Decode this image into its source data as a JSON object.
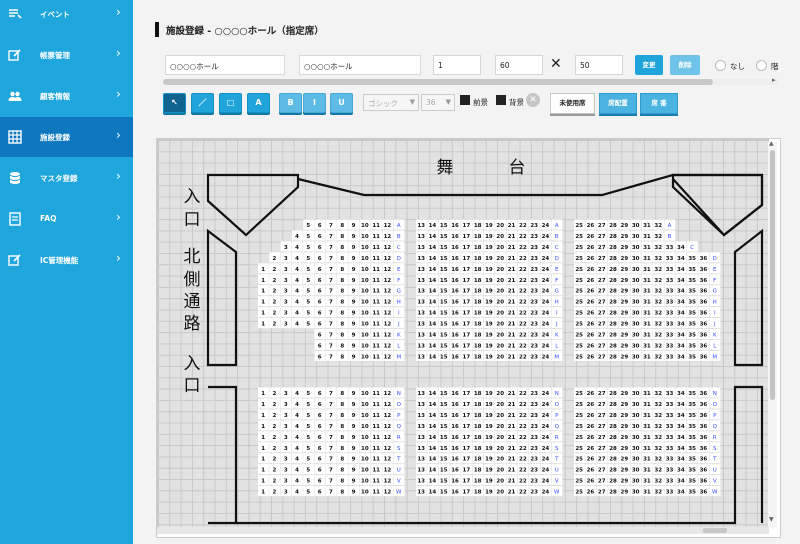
{
  "sidebar": {
    "items": [
      {
        "label": "イベント",
        "icon": "event-list-icon",
        "active": false
      },
      {
        "label": "帳票管理",
        "icon": "edit-icon",
        "active": false
      },
      {
        "label": "顧客情報",
        "icon": "users-icon",
        "active": false
      },
      {
        "label": "施設登録",
        "icon": "grid-icon",
        "active": true
      },
      {
        "label": "マスタ登録",
        "icon": "database-icon",
        "active": false
      },
      {
        "label": "FAQ",
        "icon": "document-icon",
        "active": false
      },
      {
        "label": "IC管理機能",
        "icon": "edit-icon",
        "active": false
      }
    ]
  },
  "header": {
    "title": "施設登録 - ○○○○ホール（指定席）"
  },
  "form": {
    "name1": "○○○○ホール",
    "name2": "○○○○ホール",
    "floor": "1",
    "rows": "60",
    "times": "✕",
    "cols": "50",
    "change_label": "変更",
    "delete_label": "削除",
    "radio1": "なし",
    "radio2": "階"
  },
  "toolbar": {
    "tools": [
      "↖",
      "／",
      "□",
      "A"
    ],
    "styles": [
      "B",
      "I",
      "U"
    ],
    "font": "ゴシック",
    "size": "36",
    "fg_label": "前景",
    "bg_label": "背景",
    "unused_label": "未使用席",
    "seatmap_label": "席配置",
    "seatno_label": "席 番"
  },
  "colors": {
    "sidebar": "#1ea6dd",
    "sidebar_active": "#0d78bf",
    "button": "#21a4da"
  },
  "map": {
    "stage_text": [
      "舞",
      "台"
    ],
    "left_labels": [
      "入",
      "口",
      "北",
      "側",
      "通",
      "路",
      "入",
      "口"
    ],
    "rows": [
      "A",
      "B",
      "C",
      "D",
      "E",
      "F",
      "G",
      "H",
      "I",
      "J",
      "K",
      "L",
      "M",
      "N",
      "O",
      "P",
      "Q",
      "R",
      "S",
      "T",
      "U",
      "V",
      "W"
    ]
  }
}
